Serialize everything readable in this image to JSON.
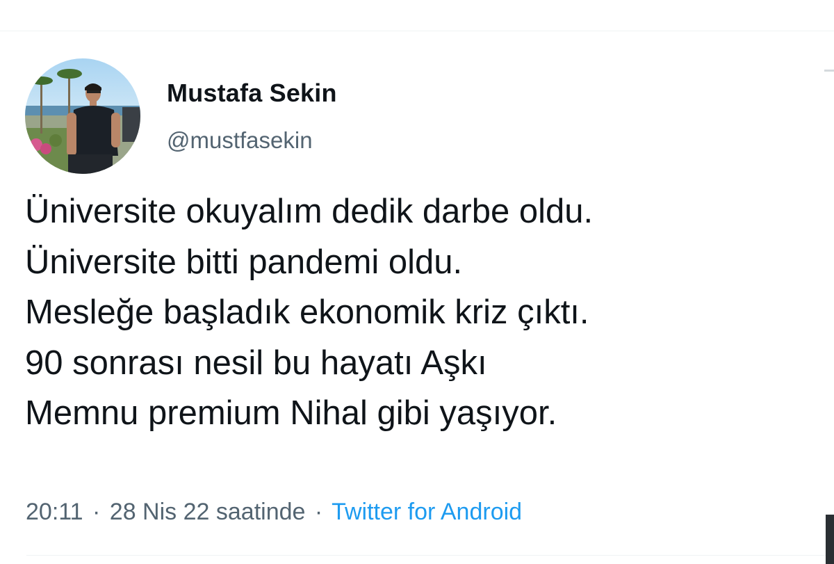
{
  "tweet": {
    "author": {
      "name": "Mustafa Sekin",
      "handle": "@mustfasekin"
    },
    "lines": [
      "Üniversite okuyalım dedik darbe oldu.",
      "Üniversite bitti pandemi oldu.",
      "Mesleğe başladık ekonomik kriz çıktı.",
      "90 sonrası nesil bu hayatı Aşkı",
      "Memnu premium Nihal gibi yaşıyor."
    ],
    "meta": {
      "time": "20:11",
      "separator": "·",
      "date": "28 Nis 22 saatinde",
      "source": "Twitter for Android"
    }
  },
  "colors": {
    "text": "#0f1419",
    "secondary": "#536471",
    "link": "#1d9bf0",
    "divider": "#eff3f4"
  }
}
